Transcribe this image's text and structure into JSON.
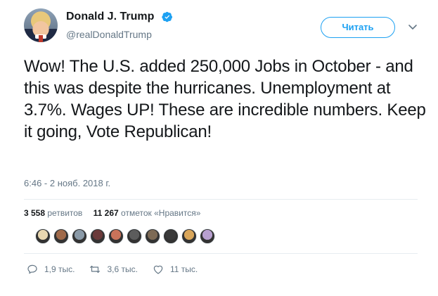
{
  "user": {
    "display_name": "Donald J. Trump",
    "handle": "@realDonaldTrump",
    "verified": true
  },
  "follow_button_label": "Читать",
  "tweet": {
    "text": "Wow! The U.S. added 250,000 Jobs in October - and this was despite the hurricanes. Unemployment at 3.7%. Wages UP! These are incredible numbers. Keep it going, Vote Republican!",
    "timestamp": "6:46 - 2 нояб. 2018 г."
  },
  "stats": {
    "retweets_count": "3 558",
    "retweets_label": "ретвитов",
    "likes_count": "11 267",
    "likes_label": "отметок «Нравится»"
  },
  "actions": {
    "replies": "1,9 тыс.",
    "retweets": "3,6 тыс.",
    "likes": "11 тыс."
  },
  "colors": {
    "accent": "#1da1f2",
    "text": "#14171a",
    "muted": "#657786",
    "divider": "#e6ecf0"
  },
  "liker_avatar_colors": [
    "#e8d7b0",
    "#a06a4a",
    "#8a9aa8",
    "#6b3a3a",
    "#c9735a",
    "#5c5c5c",
    "#7d6a55",
    "#3a3a3a",
    "#d9a65a",
    "#b8a0d0"
  ]
}
